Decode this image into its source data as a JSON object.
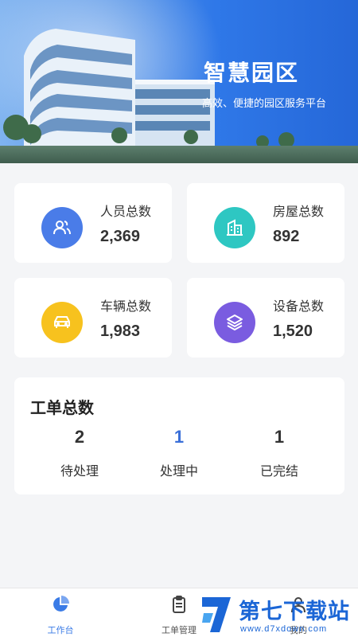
{
  "banner": {
    "title": "智慧园区",
    "subtitle": "高效、便捷的园区服务平台"
  },
  "stats": [
    {
      "label": "人员总数",
      "value": "2,369",
      "icon": "people-icon",
      "color": "#4a7ce8"
    },
    {
      "label": "房屋总数",
      "value": "892",
      "icon": "building-icon",
      "color": "#2ec7c2"
    },
    {
      "label": "车辆总数",
      "value": "1,983",
      "icon": "car-icon",
      "color": "#f7c21e"
    },
    {
      "label": "设备总数",
      "value": "1,520",
      "icon": "layers-icon",
      "color": "#7a5ce0"
    }
  ],
  "work_orders": {
    "title": "工单总数",
    "items": [
      {
        "count": "2",
        "label": "待处理",
        "color": "#333333"
      },
      {
        "count": "1",
        "label": "处理中",
        "color": "#3a6fd8"
      },
      {
        "count": "1",
        "label": "已完结",
        "color": "#333333"
      }
    ]
  },
  "tabbar": {
    "items": [
      {
        "label": "工作台",
        "icon": "pie-chart-icon",
        "active": true,
        "color": "#3a7be6"
      },
      {
        "label": "工单管理",
        "icon": "clipboard-icon",
        "active": false
      },
      {
        "label": "我的",
        "icon": "user-icon",
        "active": false
      }
    ]
  },
  "watermark": {
    "text": "第七下载站",
    "url": "www.d7xdown.com"
  }
}
